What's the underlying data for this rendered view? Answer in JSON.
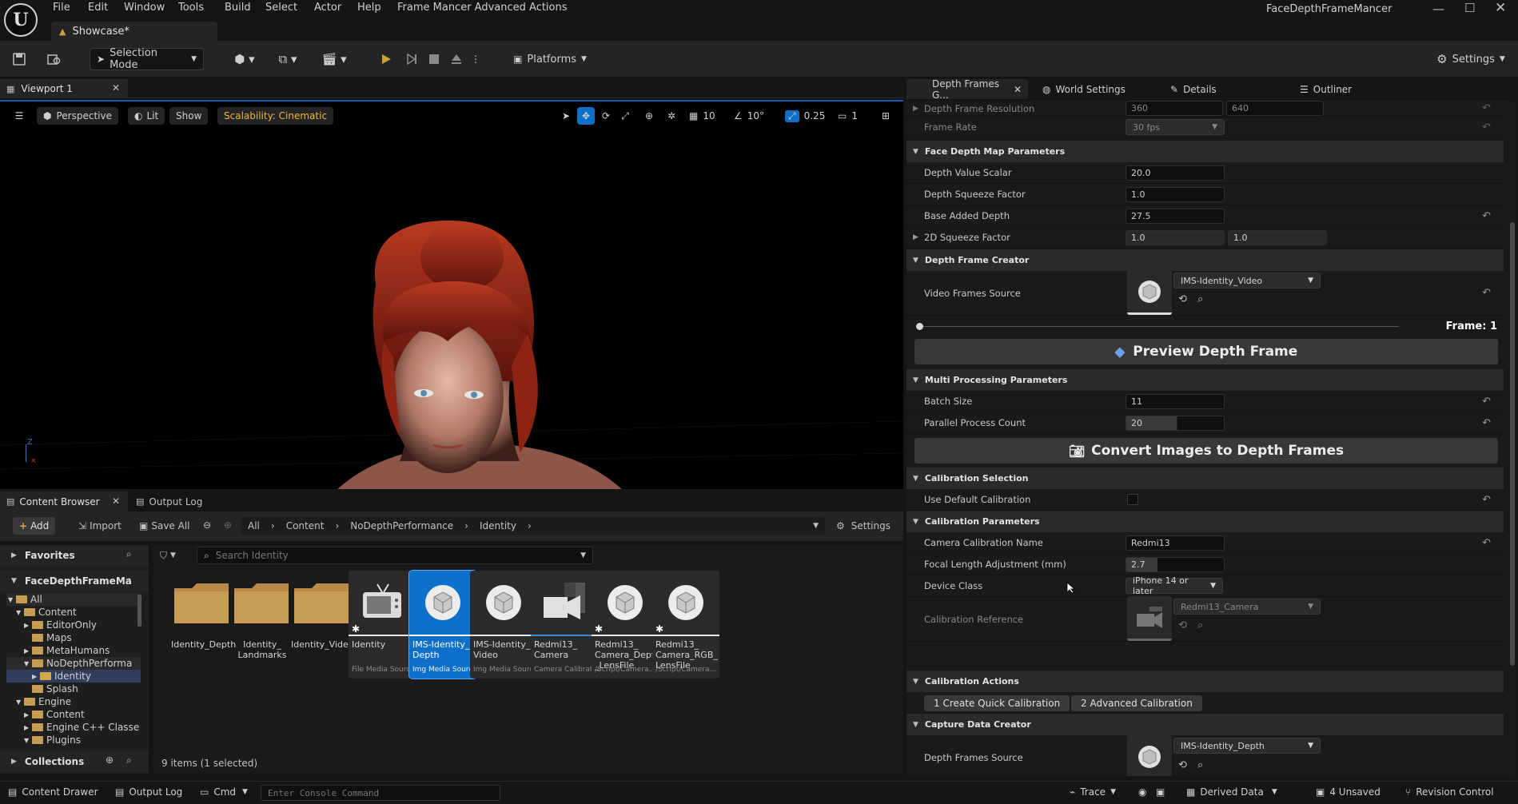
{
  "window": {
    "app_name": "FaceDepthFrameMancer",
    "menu": [
      "File",
      "Edit",
      "Window",
      "Tools",
      "Build",
      "Select",
      "Actor",
      "Help",
      "Frame Mancer Advanced Actions"
    ],
    "level_tab": "Showcase*"
  },
  "toolbar": {
    "selection_mode": "Selection Mode",
    "platforms": "Platforms",
    "settings": "Settings"
  },
  "viewport": {
    "tab_label": "Viewport 1",
    "perspective": "Perspective",
    "lit": "Lit",
    "show": "Show",
    "scalability": "Scalability: Cinematic",
    "grid_size": "10",
    "rotation_snap": "10°",
    "scale_snap": "0.25",
    "camera_speed": "1",
    "axis_label": "Z"
  },
  "right_tabs": [
    "Depth Frames G...",
    "World Settings",
    "Details",
    "Outliner"
  ],
  "details": {
    "depth_frame_resolution": {
      "label": "Depth Frame Resolution",
      "v1": "360",
      "v2": "640"
    },
    "frame_rate": {
      "label": "Frame Rate",
      "value": "30 fps"
    },
    "sec_face_depth": "Face Depth Map Parameters",
    "depth_value_scalar": {
      "label": "Depth Value Scalar",
      "value": "20.0"
    },
    "depth_squeeze_factor": {
      "label": "Depth Squeeze Factor",
      "value": "1.0"
    },
    "base_added_depth": {
      "label": "Base Added Depth",
      "value": "27.5"
    },
    "squeeze_2d": {
      "label": "2D Squeeze Factor",
      "v1": "1.0",
      "v2": "1.0"
    },
    "sec_depth_frame_creator": "Depth Frame Creator",
    "video_frames_source": {
      "label": "Video Frames Source",
      "value": "IMS-Identity_Video"
    },
    "frame_indicator": "Frame: 1",
    "preview_button": "Preview Depth Frame",
    "sec_multi_processing": "Multi Processing Parameters",
    "batch_size": {
      "label": "Batch Size",
      "value": "11"
    },
    "parallel_process_count": {
      "label": "Parallel Process Count",
      "value": "20"
    },
    "convert_button": "Convert Images to Depth Frames",
    "sec_calibration_selection": "Calibration Selection",
    "use_default_calibration": {
      "label": "Use Default Calibration",
      "checked": false
    },
    "sec_calibration_parameters": "Calibration Parameters",
    "camera_calibration_name": {
      "label": "Camera Calibration Name",
      "value": "Redmi13"
    },
    "focal_length_adjustment": {
      "label": "Focal Length Adjustment (mm)",
      "value": "2.7"
    },
    "device_class": {
      "label": "Device Class",
      "value": "iPhone 14 or later"
    },
    "calibration_reference": {
      "label": "Calibration Reference",
      "value": "Redmi13_Camera"
    },
    "sec_calibration_actions": "Calibration Actions",
    "quick_calibration_button": "1 Create Quick Calibration",
    "advanced_calibration_button": "2 Advanced Calibration",
    "sec_capture_data_creator": "Capture Data Creator",
    "depth_frames_source": {
      "label": "Depth Frames Source",
      "value": "IMS-Identity_Depth"
    }
  },
  "content_browser": {
    "tab_label": "Content Browser",
    "output_log_tab": "Output Log",
    "add": "Add",
    "import": "Import",
    "save_all": "Save All",
    "breadcrumb": [
      "All",
      "Content",
      "NoDepthPerformance",
      "Identity"
    ],
    "settings": "Settings",
    "favorites": "Favorites",
    "project_root": "FaceDepthFrameMa",
    "tree": [
      {
        "label": "All",
        "indent": 0
      },
      {
        "label": "Content",
        "indent": 1
      },
      {
        "label": "EditorOnly",
        "indent": 2
      },
      {
        "label": "Maps",
        "indent": 2
      },
      {
        "label": "MetaHumans",
        "indent": 2
      },
      {
        "label": "NoDepthPerforma",
        "indent": 2
      },
      {
        "label": "Identity",
        "indent": 3
      },
      {
        "label": "Splash",
        "indent": 2
      },
      {
        "label": "Engine",
        "indent": 1
      },
      {
        "label": "Content",
        "indent": 2
      },
      {
        "label": "Engine C++ Classe",
        "indent": 2
      },
      {
        "label": "Plugins",
        "indent": 2
      }
    ],
    "collections": "Collections",
    "search_placeholder": "Search Identity",
    "assets": [
      {
        "name": "Identity_Depth",
        "type": "",
        "kind": "folder"
      },
      {
        "name": "Identity_ Landmarks",
        "type": "",
        "kind": "folder"
      },
      {
        "name": "Identity_Video",
        "type": "",
        "kind": "folder"
      },
      {
        "name": "Identity",
        "type": "File Media Source",
        "kind": "tv"
      },
      {
        "name": "IMS-Identity_ Depth",
        "type": "Img Media Source",
        "kind": "sphere"
      },
      {
        "name": "IMS-Identity_ Video",
        "type": "Img Media Source",
        "kind": "sphere"
      },
      {
        "name": "Redmi13_ Camera",
        "type": "Camera Calibration",
        "kind": "camera"
      },
      {
        "name": "Redmi13_ Camera_Depth _LensFile",
        "type": "/Script/Camera...",
        "kind": "sphere"
      },
      {
        "name": "Redmi13_ Camera_RGB_ LensFile",
        "type": "/Script/Camera...",
        "kind": "sphere"
      }
    ],
    "item_count": "9 items (1 selected)"
  },
  "statusbar": {
    "content_drawer": "Content Drawer",
    "output_log": "Output Log",
    "cmd": "Cmd",
    "console_placeholder": "Enter Console Command",
    "trace": "Trace",
    "derived_data": "Derived Data",
    "unsaved": "4 Unsaved",
    "revision_control": "Revision Control"
  },
  "colors": {
    "accent": "#0e70c9",
    "selection": "#0e70c9",
    "play": "#c9a227"
  }
}
